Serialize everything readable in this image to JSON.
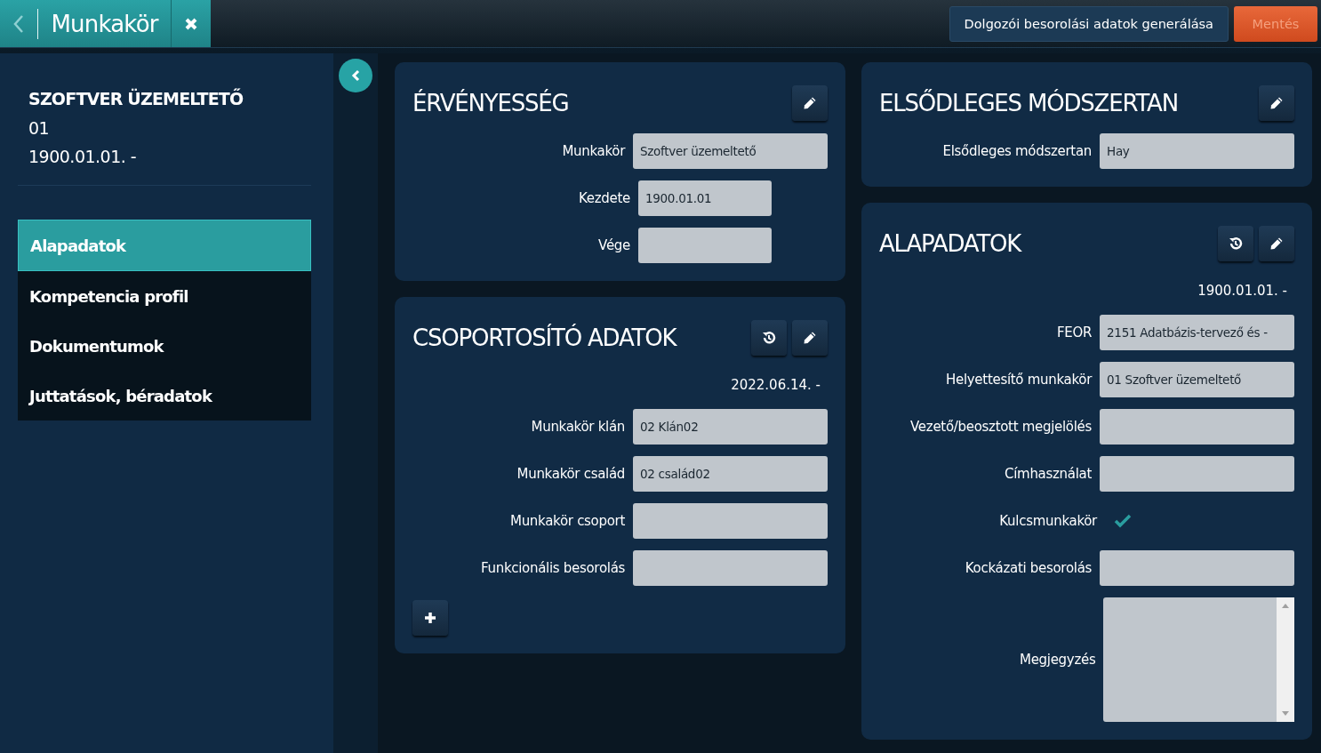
{
  "topbar": {
    "title": "Munkakör",
    "actions": [
      {
        "label": "Dolgozói besorolási adatok generálása",
        "kind": "secondary",
        "disabled": false
      },
      {
        "label": "Mentés",
        "kind": "primary",
        "disabled": true
      }
    ]
  },
  "sidebar": {
    "name": "SZOFTVER ÜZEMELTETŐ",
    "code": "01",
    "period": "1900.01.01. -",
    "items": [
      {
        "label": "Alapadatok",
        "selected": true
      },
      {
        "label": "Kompetencia profil",
        "selected": false
      },
      {
        "label": "Dokumentumok",
        "selected": false
      },
      {
        "label": "Juttatások, béradatok",
        "selected": false
      }
    ]
  },
  "columns": [
    {
      "cards": [
        {
          "title": "ÉRVÉNYESSÉG",
          "buttons": [
            {
              "kind": "edit"
            }
          ],
          "fields": [
            {
              "kind": "text",
              "label": "Munkakör",
              "value": "Szoftver üzemeltető"
            },
            {
              "kind": "date",
              "label": "Kezdete",
              "value": "1900.01.01"
            },
            {
              "kind": "date",
              "label": "Vége"
            }
          ]
        },
        {
          "title": "CSOPORTOSÍTÓ ADATOK",
          "buttons": [
            {
              "kind": "history"
            },
            {
              "kind": "edit"
            }
          ],
          "period": "2022.06.14. -",
          "add_button": true,
          "fields": [
            {
              "kind": "text",
              "label": "Munkakör klán",
              "value": "02 Klán02"
            },
            {
              "kind": "text",
              "label": "Munkakör család",
              "value": "02 család02"
            },
            {
              "kind": "text",
              "label": "Munkakör csoport"
            },
            {
              "kind": "text",
              "label": "Funkcionális besorolás"
            }
          ]
        }
      ]
    },
    {
      "cards": [
        {
          "title": "ELSŐDLEGES MÓDSZERTAN",
          "buttons": [
            {
              "kind": "edit"
            }
          ],
          "fields": [
            {
              "kind": "text",
              "label": "Elsődleges módszertan",
              "value": "Hay"
            }
          ]
        },
        {
          "title": "ALAPADATOK",
          "buttons": [
            {
              "kind": "history"
            },
            {
              "kind": "edit"
            }
          ],
          "period": "1900.01.01. -",
          "fields": [
            {
              "kind": "text",
              "label": "FEOR",
              "value": "2151 Adatbázis-tervező és -"
            },
            {
              "kind": "text",
              "label": "Helyettesítő munkakör",
              "value": "01 Szoftver üzemeltető"
            },
            {
              "kind": "text",
              "label": "Vezető/beosztott megjelölés"
            },
            {
              "kind": "text",
              "label": "Címhasználat"
            },
            {
              "kind": "check",
              "label": "Kulcsmunkakör",
              "checked": true
            },
            {
              "kind": "text",
              "label": "Kockázati besorolás"
            },
            {
              "kind": "textarea",
              "label": "Megjegyzés"
            }
          ]
        }
      ]
    }
  ]
}
